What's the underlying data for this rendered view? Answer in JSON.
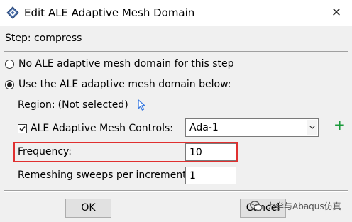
{
  "window": {
    "title": "Edit ALE Adaptive Mesh Domain",
    "close_glyph": "✕",
    "title_icon": "abaqus-diamond-icon"
  },
  "step": {
    "label": "Step:  compress"
  },
  "options": {
    "no_domain_label": "No ALE adaptive mesh domain for this step",
    "use_domain_label": "Use the ALE adaptive mesh domain below:",
    "selected": "use_domain"
  },
  "region": {
    "label": "Region:",
    "value": "(Not selected)",
    "pick_icon": "arrow-cursor-icon"
  },
  "controls": {
    "checkbox_label": "ALE Adaptive Mesh Controls:",
    "checked": true,
    "selected_value": "Ada-1",
    "create_glyph": "+"
  },
  "frequency": {
    "label": "Frequency:",
    "value": "10"
  },
  "remeshing": {
    "label": "Remeshing sweeps per increment:",
    "value": "1"
  },
  "buttons": {
    "ok_label": "OK",
    "cancel_label": "Cancel"
  },
  "watermark": {
    "text": "力学与Abaqus仿真",
    "icon": "wechat-icon"
  },
  "colors": {
    "highlight": "#e03030",
    "plus": "#1a9a3a",
    "cursor_icon": "#3b7be0"
  }
}
